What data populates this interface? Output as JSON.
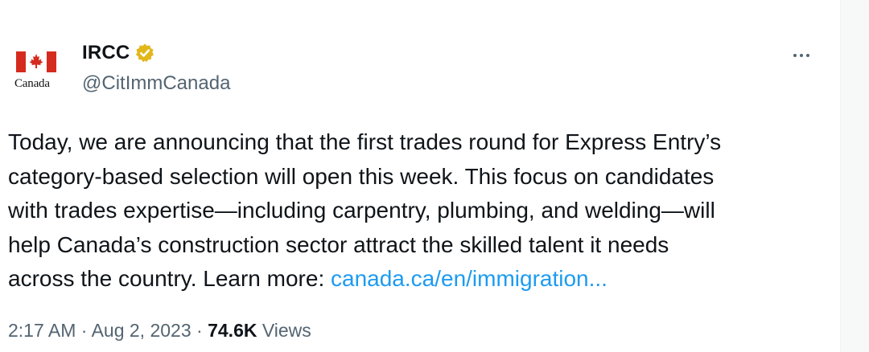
{
  "tweet": {
    "display_name": "IRCC",
    "handle": "@CitImmCanada",
    "avatar_wordmark": "Canada",
    "more_label": "...",
    "body_lines": [
      "Today, we are announcing that the first trades round for Express Entry’s",
      "category-based selection will open this week. This focus on candidates",
      "with trades expertise—including carpentry, plumbing, and welding—will",
      "help Canada’s construction sector attract the skilled talent it needs"
    ],
    "body_last_text": "across the country. Learn more: ",
    "link_text": "canada.ca/en/immigration...",
    "time": "2:17 AM",
    "date": "Aug 2, 2023",
    "separator": "·",
    "views_count": "74.6K",
    "views_label": "Views"
  },
  "icons": {
    "avatar": "canada-flag-icon",
    "verified": "verified-badge-icon",
    "more": "more-options-icon"
  },
  "colors": {
    "flag_red": "#d52b1e",
    "verified_gold": "#e2b719",
    "link": "#1d9bf0",
    "secondary_text": "#536471",
    "primary_text": "#0f1419"
  }
}
